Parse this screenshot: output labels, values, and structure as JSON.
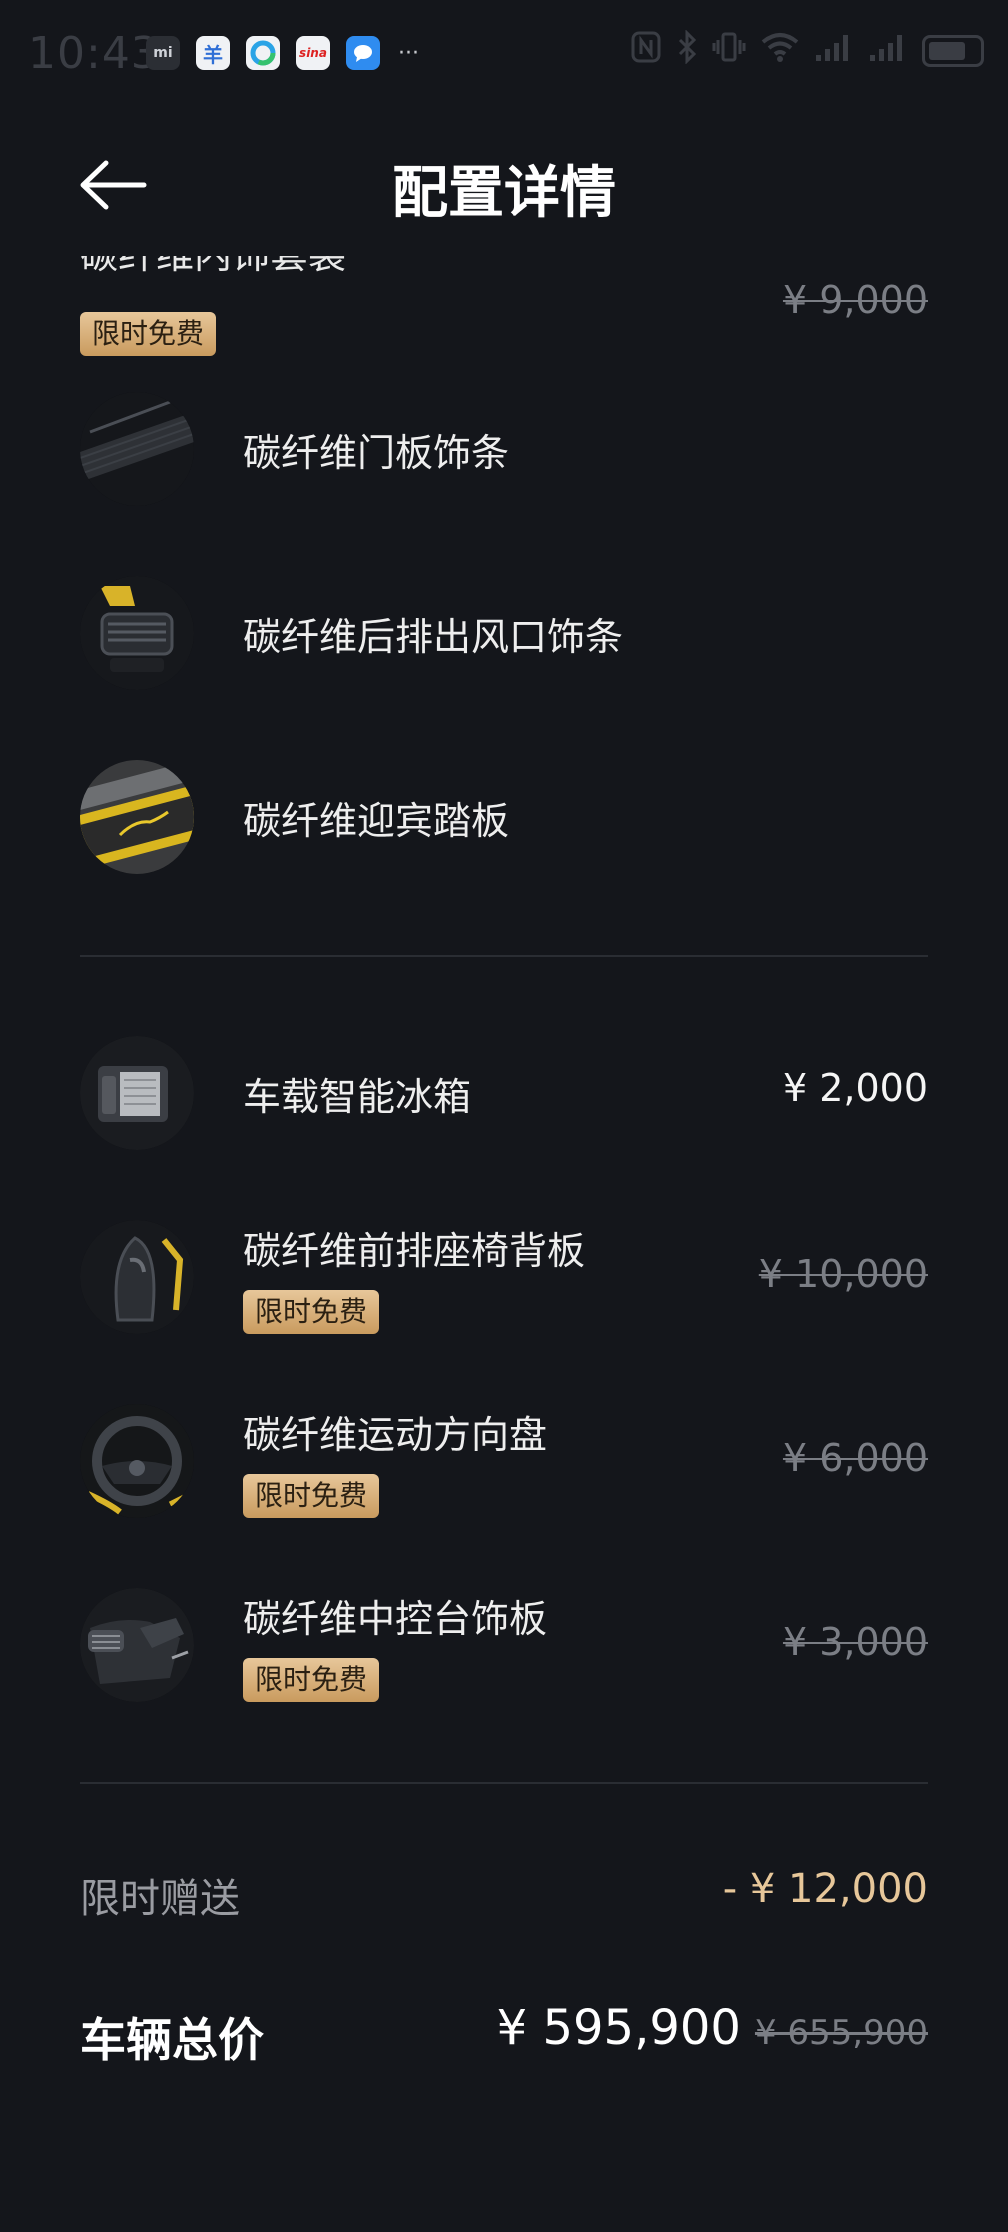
{
  "status_bar": {
    "time": "10:43",
    "notifications": [
      "mi",
      "羊",
      "",
      "sina",
      ""
    ],
    "more": "···"
  },
  "header": {
    "title": "配置详情"
  },
  "group1": {
    "cut_title": "碳纤维内饰套装",
    "badge": "限时免费",
    "price": "¥ 9,000",
    "items": [
      {
        "name": "碳纤维门板饰条"
      },
      {
        "name": "碳纤维后排出风口饰条"
      },
      {
        "name": "碳纤维迎宾踏板"
      }
    ]
  },
  "group2": {
    "items": [
      {
        "name": "车载智能冰箱",
        "price": "¥ 2,000"
      },
      {
        "name": "碳纤维前排座椅背板",
        "badge": "限时免费",
        "price": "¥ 10,000"
      },
      {
        "name": "碳纤维运动方向盘",
        "badge": "限时免费",
        "price": "¥ 6,000"
      },
      {
        "name": "碳纤维中控台饰板",
        "badge": "限时免费",
        "price": "¥ 3,000"
      }
    ]
  },
  "summary": {
    "gift_label": "限时赠送",
    "gift_value": "- ¥ 12,000",
    "total_label": "车辆总价",
    "total_price": "¥ 595,900",
    "total_original": "¥ 655,900"
  },
  "colors": {
    "background": "#14161b",
    "badge_gold": "#d7b07a",
    "gift_gold": "#e7c79a"
  }
}
